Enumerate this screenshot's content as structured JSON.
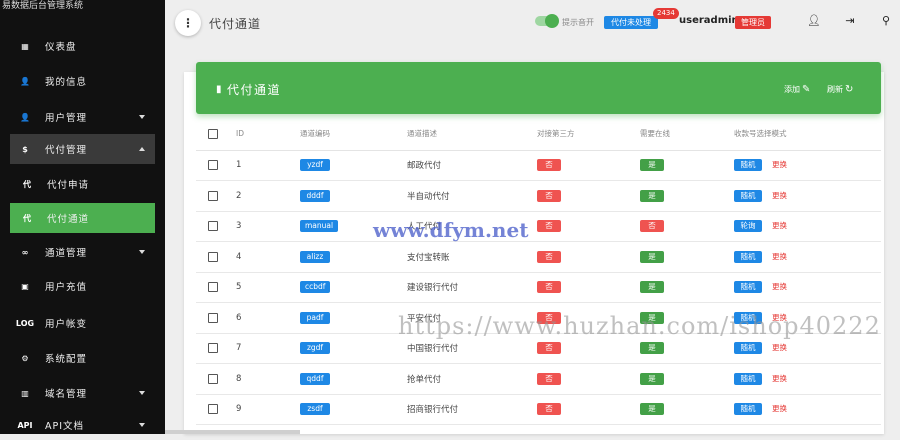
{
  "app": {
    "brand": "易数据后台管理系统"
  },
  "sidebar": {
    "items": [
      {
        "label": "仪表盘",
        "icon": "dashboard-icon",
        "glyph": "▦",
        "caret": ""
      },
      {
        "label": "我的信息",
        "icon": "person-icon",
        "glyph": "👤",
        "caret": ""
      },
      {
        "label": "用户管理",
        "icon": "person-icon",
        "glyph": "👤",
        "caret": "down"
      },
      {
        "label": "代付管理",
        "icon": "dollar-icon",
        "glyph": "$",
        "caret": "up"
      },
      {
        "label": "代付申请",
        "icon": "dai-text-icon",
        "glyph": "代",
        "caret": ""
      },
      {
        "label": "代付通道",
        "icon": "dai-text-icon",
        "glyph": "代",
        "caret": ""
      },
      {
        "label": "通道管理",
        "icon": "infinity-icon",
        "glyph": "∞",
        "caret": "down"
      },
      {
        "label": "用户充值",
        "icon": "money-icon",
        "glyph": "▣",
        "caret": ""
      },
      {
        "label": "用户帐变",
        "icon": "log-icon",
        "glyph": "LOG",
        "caret": ""
      },
      {
        "label": "系统配置",
        "icon": "gear-icon",
        "glyph": "⚙",
        "caret": ""
      },
      {
        "label": "域名管理",
        "icon": "building-icon",
        "glyph": "▥",
        "caret": "down"
      },
      {
        "label": "API文档",
        "icon": "api-icon",
        "glyph": "API",
        "caret": "down"
      }
    ]
  },
  "topbar": {
    "menu_glyph": "⋮",
    "title": "代付通道",
    "toggle_label": "提示音开",
    "pending_label": "代付未处理",
    "pending_count": "2434",
    "username": "useradmin",
    "role": "管理员",
    "icons": [
      "person-icon",
      "logout-icon",
      "key-icon"
    ]
  },
  "card": {
    "title": "代付通道",
    "title_glyph": "▮",
    "add_label": "添加",
    "add_glyph": "✎",
    "refresh_label": "刷新",
    "refresh_glyph": "↻"
  },
  "table": {
    "headers": [
      "ID",
      "通道编码",
      "通道描述",
      "对接第三方",
      "需要在线",
      "收款号选择模式"
    ],
    "change_label": "更换",
    "rows": [
      {
        "id": "1",
        "code": "yzdf",
        "desc": "邮政代付",
        "third": "否",
        "online": "是",
        "mode": "随机"
      },
      {
        "id": "2",
        "code": "dddf",
        "desc": "半自动代付",
        "third": "否",
        "online": "是",
        "mode": "随机"
      },
      {
        "id": "3",
        "code": "manual",
        "desc": "人工代付",
        "third": "否",
        "online": "否",
        "mode": "轮询"
      },
      {
        "id": "4",
        "code": "alizz",
        "desc": "支付宝转账",
        "third": "否",
        "online": "是",
        "mode": "随机"
      },
      {
        "id": "5",
        "code": "ccbdf",
        "desc": "建设银行代付",
        "third": "否",
        "online": "是",
        "mode": "随机"
      },
      {
        "id": "6",
        "code": "padf",
        "desc": "平安代付",
        "third": "否",
        "online": "是",
        "mode": "随机"
      },
      {
        "id": "7",
        "code": "zgdf",
        "desc": "中国银行代付",
        "third": "否",
        "online": "是",
        "mode": "随机"
      },
      {
        "id": "8",
        "code": "qddf",
        "desc": "抢单代付",
        "third": "否",
        "online": "是",
        "mode": "随机"
      },
      {
        "id": "9",
        "code": "zsdf",
        "desc": "招商银行代付",
        "third": "否",
        "online": "是",
        "mode": "随机"
      }
    ]
  },
  "watermarks": [
    "www.dfym.net",
    "https://www.huzhan.com/ishop40222"
  ],
  "colors": {
    "accent": "#4caf50",
    "blue": "#1e88e5",
    "red": "#e53935",
    "sidebar": "#111111"
  }
}
